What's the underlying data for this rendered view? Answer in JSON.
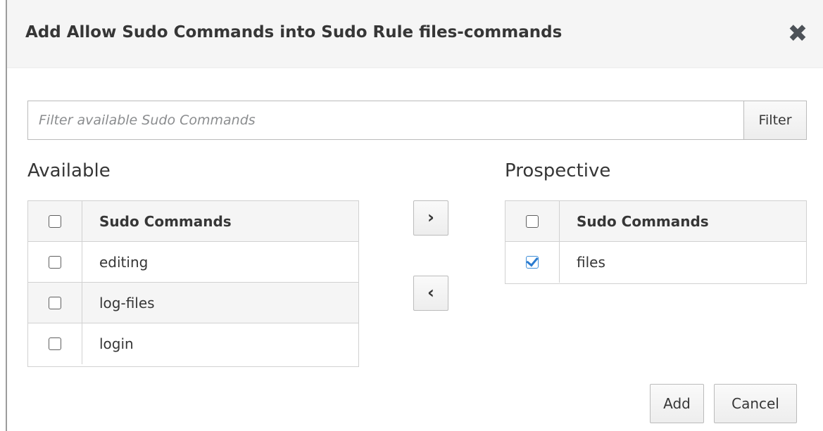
{
  "dialog": {
    "title": "Add Allow Sudo Commands into Sudo Rule files-commands",
    "close_icon": "close-icon"
  },
  "filter": {
    "placeholder": "Filter available Sudo Commands",
    "value": "",
    "button_label": "Filter"
  },
  "available": {
    "label": "Available",
    "column_header": "Sudo Commands",
    "rows": [
      {
        "name": "editing",
        "checked": false
      },
      {
        "name": "log-files",
        "checked": false
      },
      {
        "name": "login",
        "checked": false
      }
    ]
  },
  "prospective": {
    "label": "Prospective",
    "column_header": "Sudo Commands",
    "rows": [
      {
        "name": "files",
        "checked": true
      }
    ]
  },
  "move_buttons": {
    "add_icon": "chevron-right-icon",
    "add_symbol": "›",
    "remove_icon": "chevron-left-icon",
    "remove_symbol": "‹"
  },
  "footer": {
    "add_label": "Add",
    "cancel_label": "Cancel"
  },
  "colors": {
    "header_bg": "#f5f5f5",
    "checkbox_checked": "#2a7bd0",
    "text": "#363636"
  }
}
